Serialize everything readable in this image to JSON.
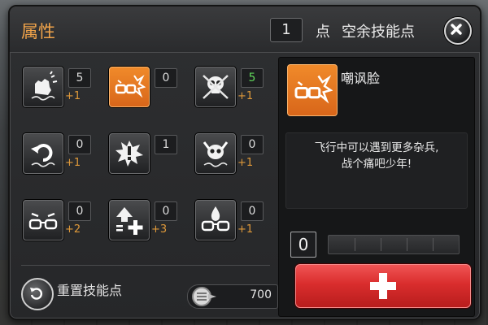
{
  "panel": {
    "title": "属性",
    "skill_points": {
      "value": "1",
      "unit": "点",
      "label": "空余技能点"
    }
  },
  "skills": [
    {
      "icon": "fist-icon",
      "level": "5",
      "bonus": "+1",
      "selected": false,
      "level_color": "#dcdcdc"
    },
    {
      "icon": "glasses-burst-icon",
      "level": "0",
      "bonus": "",
      "selected": true,
      "level_color": "#dcdcdc"
    },
    {
      "icon": "skull-crossbones-icon",
      "level": "5",
      "bonus": "+1",
      "selected": false,
      "level_color": "#5fd35a"
    },
    {
      "icon": "spin-arrow-icon",
      "level": "0",
      "bonus": "+1",
      "selected": false,
      "level_color": "#dcdcdc"
    },
    {
      "icon": "exclamation-burst-icon",
      "level": "1",
      "bonus": "",
      "selected": false,
      "level_color": "#dcdcdc"
    },
    {
      "icon": "horned-skull-icon",
      "level": "0",
      "bonus": "+1",
      "selected": false,
      "level_color": "#dcdcdc"
    },
    {
      "icon": "angry-glasses-icon",
      "level": "0",
      "bonus": "+2",
      "selected": false,
      "level_color": "#dcdcdc"
    },
    {
      "icon": "up-arrow-plus-icon",
      "level": "0",
      "bonus": "+3",
      "selected": false,
      "level_color": "#dcdcdc"
    },
    {
      "icon": "tear-glasses-icon",
      "level": "0",
      "bonus": "+1",
      "selected": false,
      "level_color": "#dcdcdc"
    }
  ],
  "reset": {
    "label": "重置技能点"
  },
  "coins": {
    "icon": "drill-coin-icon",
    "value": "700"
  },
  "detail": {
    "name": "嘲讽脸",
    "description_line1": "飞行中可以遇到更多杂兵,",
    "description_line2": "战个痛吧少年!",
    "level": "0",
    "progress_fraction": 0,
    "progress_segments": 5
  },
  "colors": {
    "accent": "#f0a34a",
    "selected": "#e8761f",
    "add_button": "#d92d2d",
    "level_green": "#5fd35a"
  }
}
